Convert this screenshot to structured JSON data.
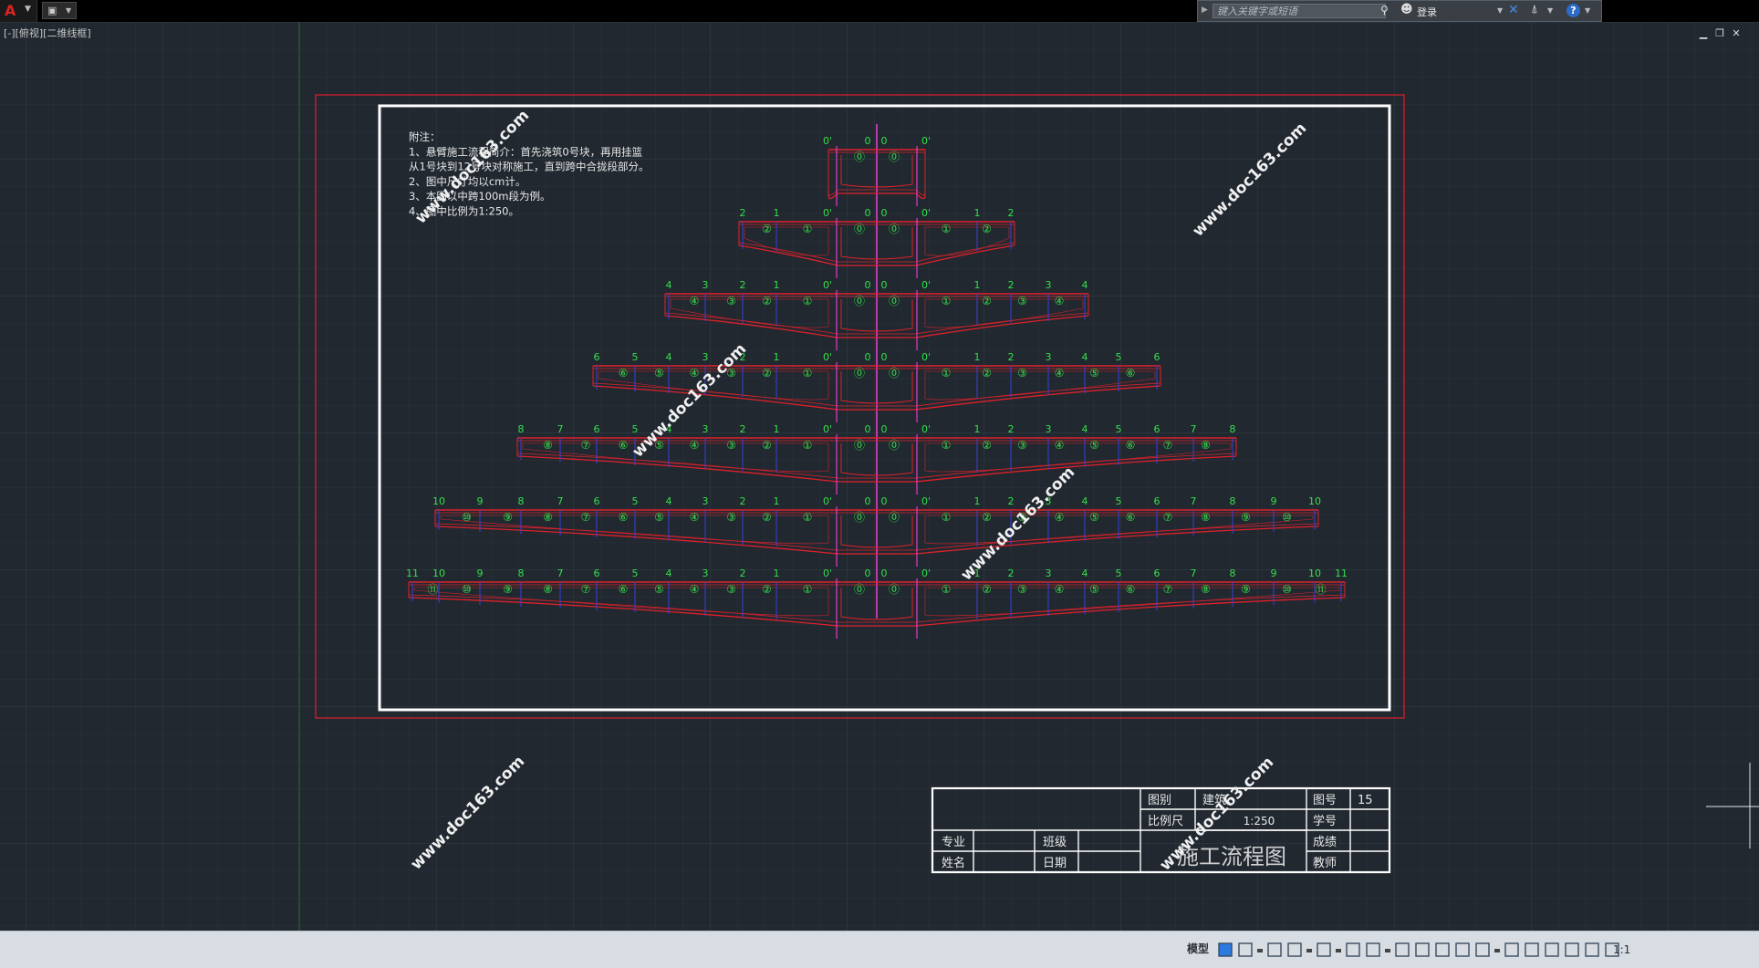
{
  "topbar": {
    "search_placeholder": "键入关键字或短语",
    "sign_in_label": "登录",
    "help_glyph": "?"
  },
  "viewport": {
    "label": "[-][俯视][二维线框]"
  },
  "drawing": {
    "notes": [
      "附注：",
      "1、悬臂施工流程简介：首先浇筑0号块，再用挂篮",
      "从1号块到12号块对称施工，直到跨中合拢段部分。",
      "2、图中尺寸均以cm计。",
      "3、本图以中跨100m段为例。",
      "4、图中比例为1:250。"
    ],
    "watermark": "www.doc163.com",
    "segment_labels": {
      "center_zero": "0",
      "center_zero_prime": "0'",
      "rows_left_max": [
        0,
        2,
        4,
        6,
        8,
        10,
        11
      ],
      "circled_digits": [
        "⓪",
        "①",
        "②",
        "③",
        "④",
        "⑤",
        "⑥",
        "⑦",
        "⑧",
        "⑨",
        "⑩",
        "⑪"
      ]
    },
    "title_block": {
      "drawing_title": "施工流程图",
      "category_label": "图别",
      "category_value": "建筑",
      "sheet_no_label": "图号",
      "sheet_no_value": "15",
      "scale_label": "比例尺",
      "scale_value": "1:250",
      "student_id_label": "学号",
      "major_label": "专业",
      "class_label": "班级",
      "grade_label": "成绩",
      "name_label": "姓名",
      "date_label": "日期",
      "teacher_label": "教师"
    },
    "colors": {
      "background": "#212830",
      "grid_minor": "#2a323c",
      "grid_major": "#333c48",
      "red": "#e0202a",
      "green": "#33e04a",
      "magenta": "#e23ecb",
      "blue": "#3c40d8",
      "white": "#ffffff"
    }
  },
  "statusbar": {
    "model_tab": "模型",
    "scale": "1:1"
  }
}
